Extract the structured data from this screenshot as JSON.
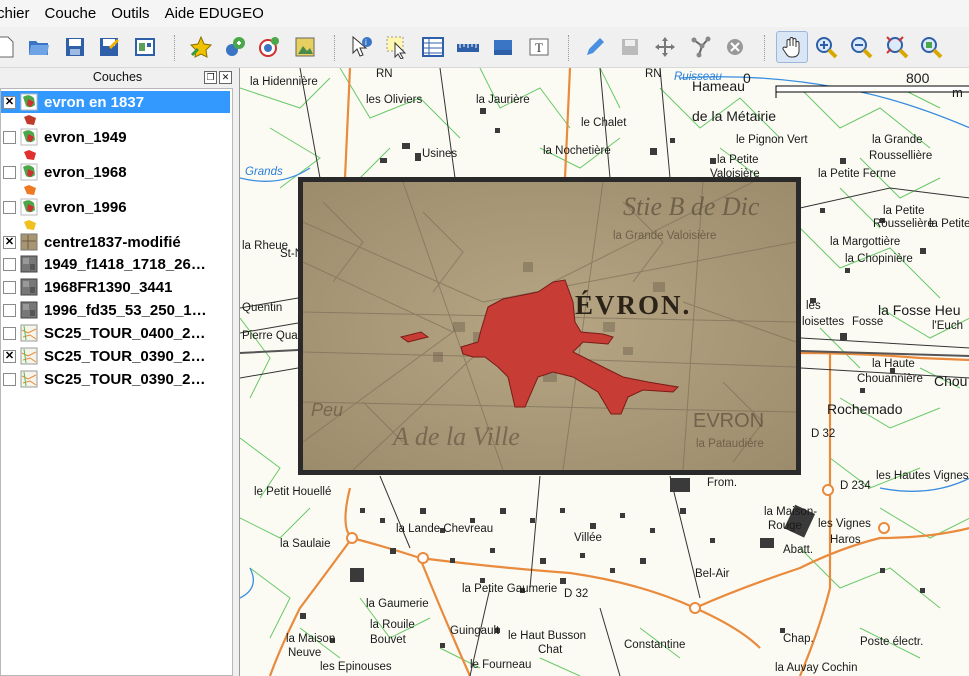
{
  "menu": [
    "chier",
    "Couche",
    "Outils",
    "Aide EDUGEO"
  ],
  "toolbar": {
    "icons": [
      "new-project-icon",
      "open-project-icon",
      "save-project-icon",
      "save-as-icon",
      "print-composer-icon",
      "add-vector-icon",
      "add-raster-icon",
      "add-wms-icon",
      "add-layer-icon",
      "identify-icon",
      "select-icon",
      "attribute-table-icon",
      "measure-icon",
      "map-tips-icon",
      "text-annotation-icon",
      "edit-pencil-icon",
      "save-edits-icon",
      "move-feature-icon",
      "node-tool-icon",
      "delete-feature-icon",
      "pan-icon",
      "zoom-in-icon",
      "zoom-out-icon",
      "zoom-full-icon",
      "zoom-layer-icon"
    ]
  },
  "layers_panel": {
    "title": "Couches",
    "layers": [
      {
        "name": "evron en 1837",
        "checked": true,
        "selected": true,
        "type": "vector",
        "symbol_color": "#c0392b"
      },
      {
        "name": "evron_1949",
        "checked": false,
        "selected": false,
        "type": "vector",
        "symbol_color": "#e03030"
      },
      {
        "name": "evron_1968",
        "checked": false,
        "selected": false,
        "type": "vector",
        "symbol_color": "#f07820"
      },
      {
        "name": "evron_1996",
        "checked": false,
        "selected": false,
        "type": "vector",
        "symbol_color": "#f0c020"
      },
      {
        "name": "centre1837-modifié",
        "checked": true,
        "selected": false,
        "type": "raster-old"
      },
      {
        "name": "1949_f1418_1718_26…",
        "checked": false,
        "selected": false,
        "type": "raster-photo"
      },
      {
        "name": "1968FR1390_3441",
        "checked": false,
        "selected": false,
        "type": "raster-photo"
      },
      {
        "name": "1996_fd35_53_250_1…",
        "checked": false,
        "selected": false,
        "type": "raster-photo"
      },
      {
        "name": "SC25_TOUR_0400_2…",
        "checked": false,
        "selected": false,
        "type": "raster-map"
      },
      {
        "name": "SC25_TOUR_0390_2…",
        "checked": true,
        "selected": false,
        "type": "raster-map"
      },
      {
        "name": "SC25_TOUR_0390_2…",
        "checked": false,
        "selected": false,
        "type": "raster-map"
      }
    ]
  },
  "map": {
    "scale": {
      "start": "0",
      "end": "800",
      "unit": "m"
    },
    "labels": [
      {
        "t": "la Hidennière"
      },
      {
        "t": "les Oliviers"
      },
      {
        "t": "la Jaurière"
      },
      {
        "t": "le Chalet"
      },
      {
        "t": "Hameau"
      },
      {
        "t": "de la Métairie"
      },
      {
        "t": "le Pignon Vert"
      },
      {
        "t": "la Nochetière"
      },
      {
        "t": "la Petite"
      },
      {
        "t": "Valoisière"
      },
      {
        "t": "la Petite Ferme"
      },
      {
        "t": "la Grande"
      },
      {
        "t": "Roussellière"
      },
      {
        "t": "la Petite"
      },
      {
        "t": "Rousselière"
      },
      {
        "t": "la Petite"
      },
      {
        "t": "la Margottière"
      },
      {
        "t": "la Chopinière"
      },
      {
        "t": "la Rheue"
      },
      {
        "t": "Quentin"
      },
      {
        "t": "Pierre Quartic"
      },
      {
        "t": "les"
      },
      {
        "t": "loisettes"
      },
      {
        "t": "Fosse"
      },
      {
        "t": "la Fosse Heu"
      },
      {
        "t": "l'Euch"
      },
      {
        "t": "la Haute"
      },
      {
        "t": "Chouannière"
      },
      {
        "t": "Chou"
      },
      {
        "t": "Rochemado"
      },
      {
        "t": "D 32"
      },
      {
        "t": "les Hautes Vignes"
      },
      {
        "t": "D 234"
      },
      {
        "t": "le Petit Houellé"
      },
      {
        "t": "la Maison-"
      },
      {
        "t": "Rouge"
      },
      {
        "t": "les Vignes"
      },
      {
        "t": "Haros"
      },
      {
        "t": "la Lande Chevreau"
      },
      {
        "t": "Villée"
      },
      {
        "t": "la Saulaie"
      },
      {
        "t": "Bel-Air"
      },
      {
        "t": "la Gaumerie"
      },
      {
        "t": "la Petite Gaumerie"
      },
      {
        "t": "la Rouile"
      },
      {
        "t": "Bouvet"
      },
      {
        "t": "Guingault"
      },
      {
        "t": "le Haut Busson"
      },
      {
        "t": "Chat"
      },
      {
        "t": "Constantine"
      },
      {
        "t": "la Maison"
      },
      {
        "t": "Neuve"
      },
      {
        "t": "les Epinouses"
      },
      {
        "t": "le Fourneau"
      },
      {
        "t": "Poste électr."
      },
      {
        "t": "la Auvay Cochin"
      },
      {
        "t": "D 32"
      },
      {
        "t": "Chap."
      },
      {
        "t": "RN"
      },
      {
        "t": "RN"
      },
      {
        "t": "Ruisseau"
      },
      {
        "t": "Grands"
      },
      {
        "t": "St-Nic"
      },
      {
        "t": "Usines"
      },
      {
        "t": "Abatt."
      },
      {
        "t": "From."
      }
    ],
    "overlay_labels": [
      "ÉVRON.",
      "Stie B de Dic",
      "la Grande Valoisière",
      "EVRON",
      "A de la Ville",
      "la Pataudière",
      "Peu"
    ]
  }
}
